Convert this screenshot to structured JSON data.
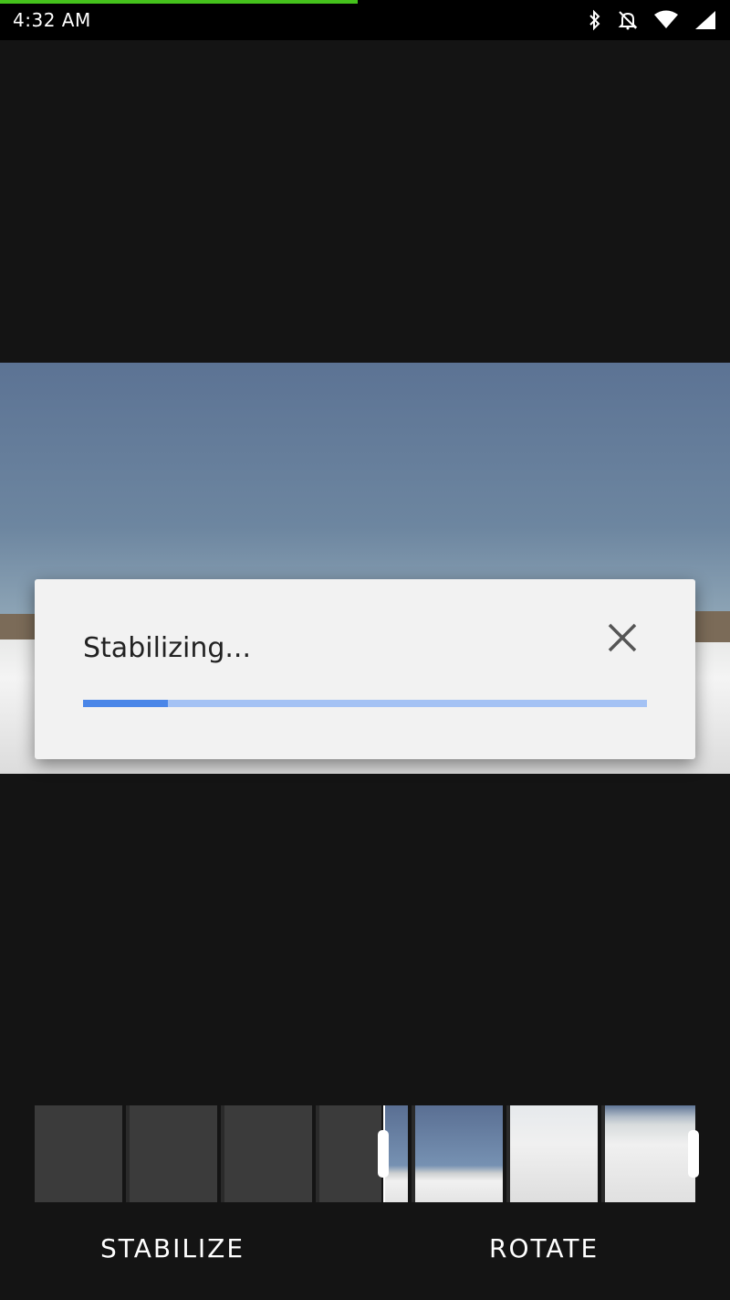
{
  "status_bar": {
    "time": "4:32 AM",
    "icons": [
      "bluetooth-icon",
      "do-not-disturb-icon",
      "wifi-icon",
      "signal-icon"
    ],
    "load_color": "#45c21c"
  },
  "dialog": {
    "title": "Stabilizing...",
    "progress": 0.15,
    "progress_color": "#4a86e8",
    "track_color": "#a4c2f4",
    "close_icon": "close-icon"
  },
  "actions": {
    "stabilize": "STABILIZE",
    "rotate": "ROTATE"
  }
}
